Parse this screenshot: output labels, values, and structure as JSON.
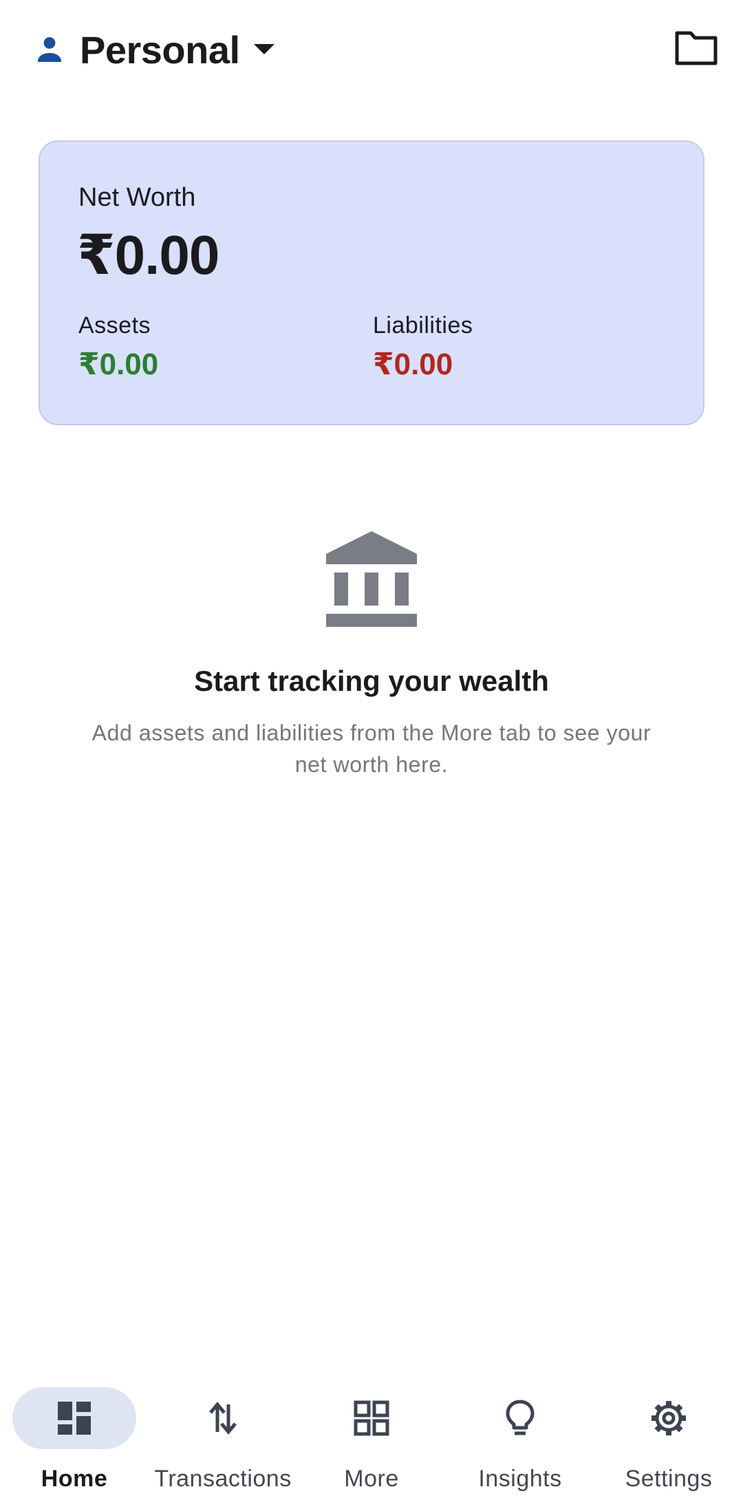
{
  "header": {
    "profile_name": "Personal",
    "profile_icon": "person-icon",
    "dropdown_icon": "caret-down-icon",
    "folder_icon": "folder-icon"
  },
  "net_worth_card": {
    "title": "Net Worth",
    "value": "₹0.00",
    "assets_label": "Assets",
    "assets_value": "₹0.00",
    "liabilities_label": "Liabilities",
    "liabilities_value": "₹0.00",
    "colors": {
      "card_background": "#d8e0fb",
      "assets": "#2e7d32",
      "liabilities": "#b3261e"
    }
  },
  "empty_state": {
    "icon": "bank-icon",
    "title": "Start tracking your wealth",
    "subtitle": "Add assets and liabilities from the More tab to see your net worth here."
  },
  "bottom_nav": {
    "items": [
      {
        "label": "Home",
        "icon": "dashboard-icon",
        "active": true
      },
      {
        "label": "Transactions",
        "icon": "swap-vertical-icon",
        "active": false
      },
      {
        "label": "More",
        "icon": "grid-icon",
        "active": false
      },
      {
        "label": "Insights",
        "icon": "lightbulb-icon",
        "active": false
      },
      {
        "label": "Settings",
        "icon": "gear-icon",
        "active": false
      }
    ]
  }
}
